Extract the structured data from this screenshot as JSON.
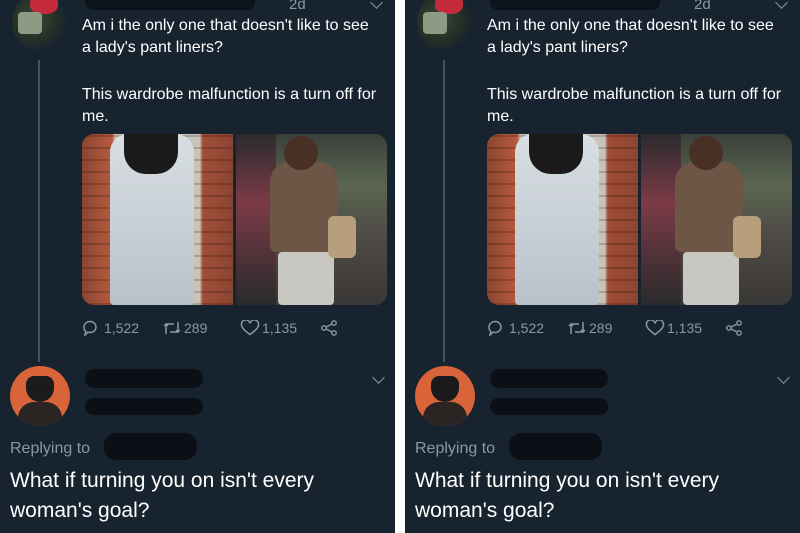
{
  "panels": [
    {
      "timestamp": "2d",
      "tweet": {
        "text_line1": "Am i the only one that doesn't like to see a lady's pant liners?",
        "text_line2": "This wardrobe malfunction is a turn off for me."
      },
      "actions": {
        "replies": "1,522",
        "retweets": "289",
        "likes": "1,135"
      },
      "reply": {
        "replying_label": "Replying to",
        "text": "What if turning you on isn't every woman's goal?"
      }
    },
    {
      "timestamp": "2d",
      "tweet": {
        "text_line1": "Am i the only one that doesn't like to see a lady's pant liners?",
        "text_line2": "This wardrobe malfunction is a turn off for me."
      },
      "actions": {
        "replies": "1,522",
        "retweets": "289",
        "likes": "1,135"
      },
      "reply": {
        "replying_label": "Replying to",
        "text": "What if turning you on isn't every woman's goal?"
      }
    }
  ],
  "colors": {
    "background": "#182330",
    "text": "#ffffff",
    "muted": "#8899a6",
    "thread": "#3d5466"
  },
  "icons": [
    "reply-icon",
    "retweet-icon",
    "like-icon",
    "share-icon",
    "chevron-down-icon"
  ]
}
